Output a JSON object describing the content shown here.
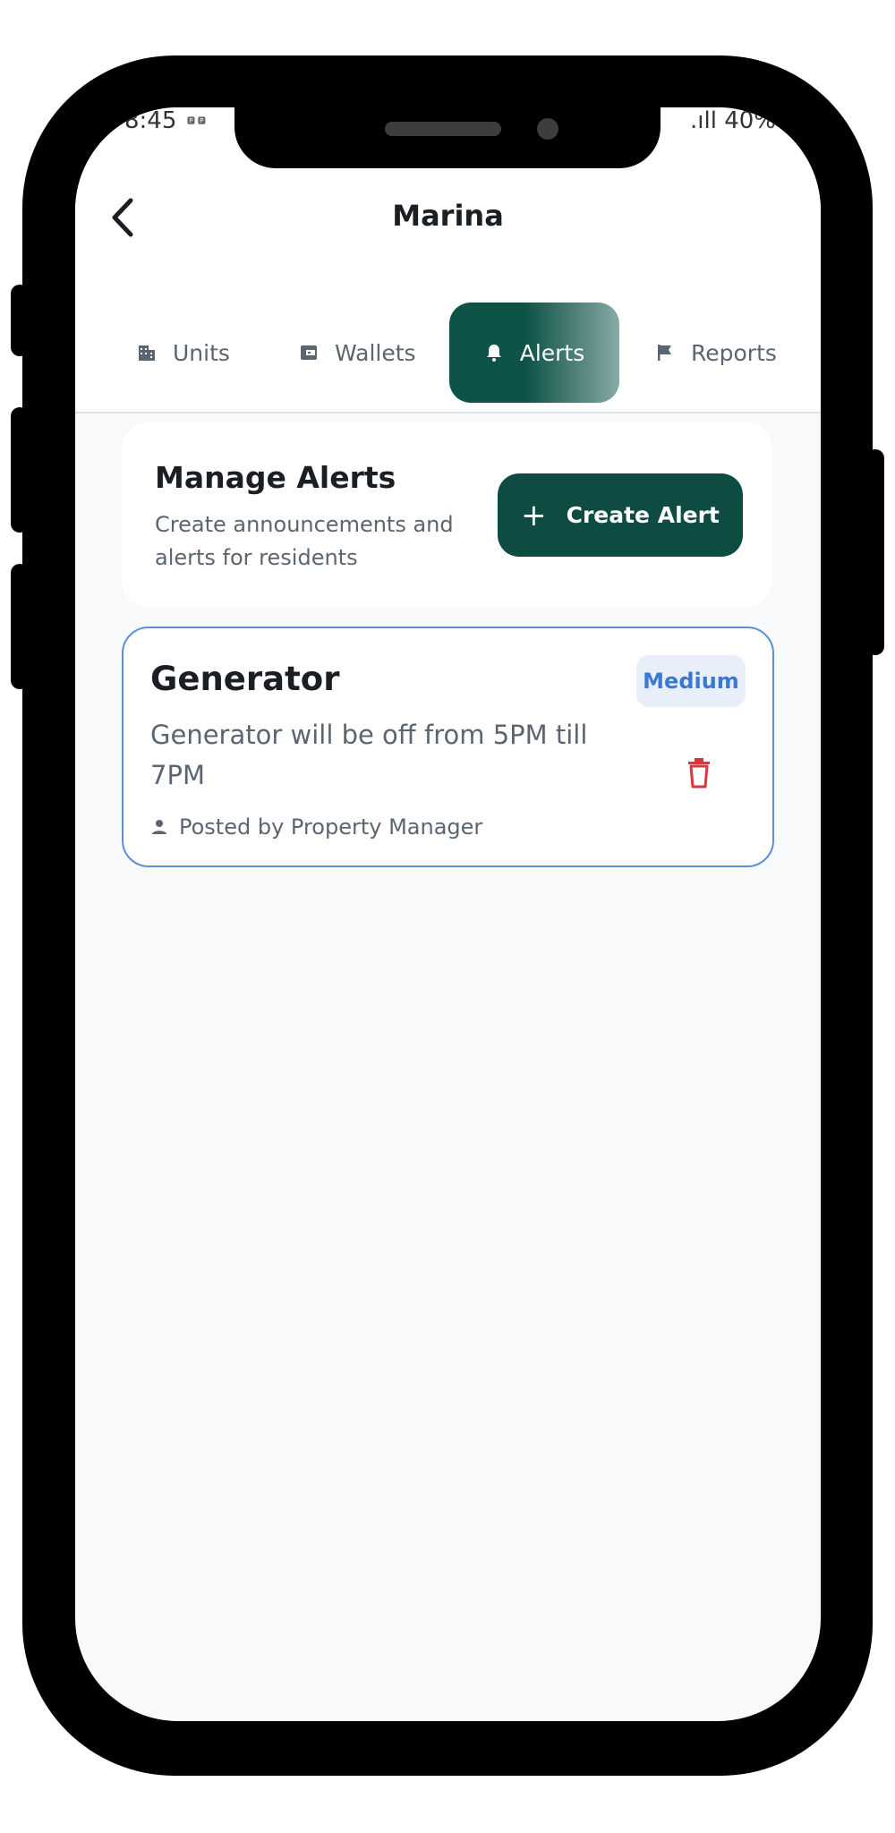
{
  "status_bar": {
    "time": "8:45",
    "mini_icons": "🅿 🅿",
    "signal_battery": ".ıll 40%"
  },
  "header": {
    "title": "Marina"
  },
  "tabs": [
    {
      "label": "Units",
      "icon": "building-icon",
      "active": false
    },
    {
      "label": "Wallets",
      "icon": "wallet-icon",
      "active": false
    },
    {
      "label": "Alerts",
      "icon": "bell-icon",
      "active": true
    },
    {
      "label": "Reports",
      "icon": "flag-icon",
      "active": false
    }
  ],
  "manage": {
    "title": "Manage Alerts",
    "subtitle": "Create announcements and alerts for residents",
    "button_label": "Create Alert",
    "button_icon": "+"
  },
  "alerts": [
    {
      "title": "Generator",
      "priority": "Medium",
      "message": "Generator will be off from 5PM till 7PM",
      "posted_by": "Posted by Property Manager"
    }
  ],
  "colors": {
    "primary": "#0e4b43",
    "badge_text": "#3a79d1",
    "delete": "#d9363e",
    "card_border": "#5b8fd6"
  }
}
